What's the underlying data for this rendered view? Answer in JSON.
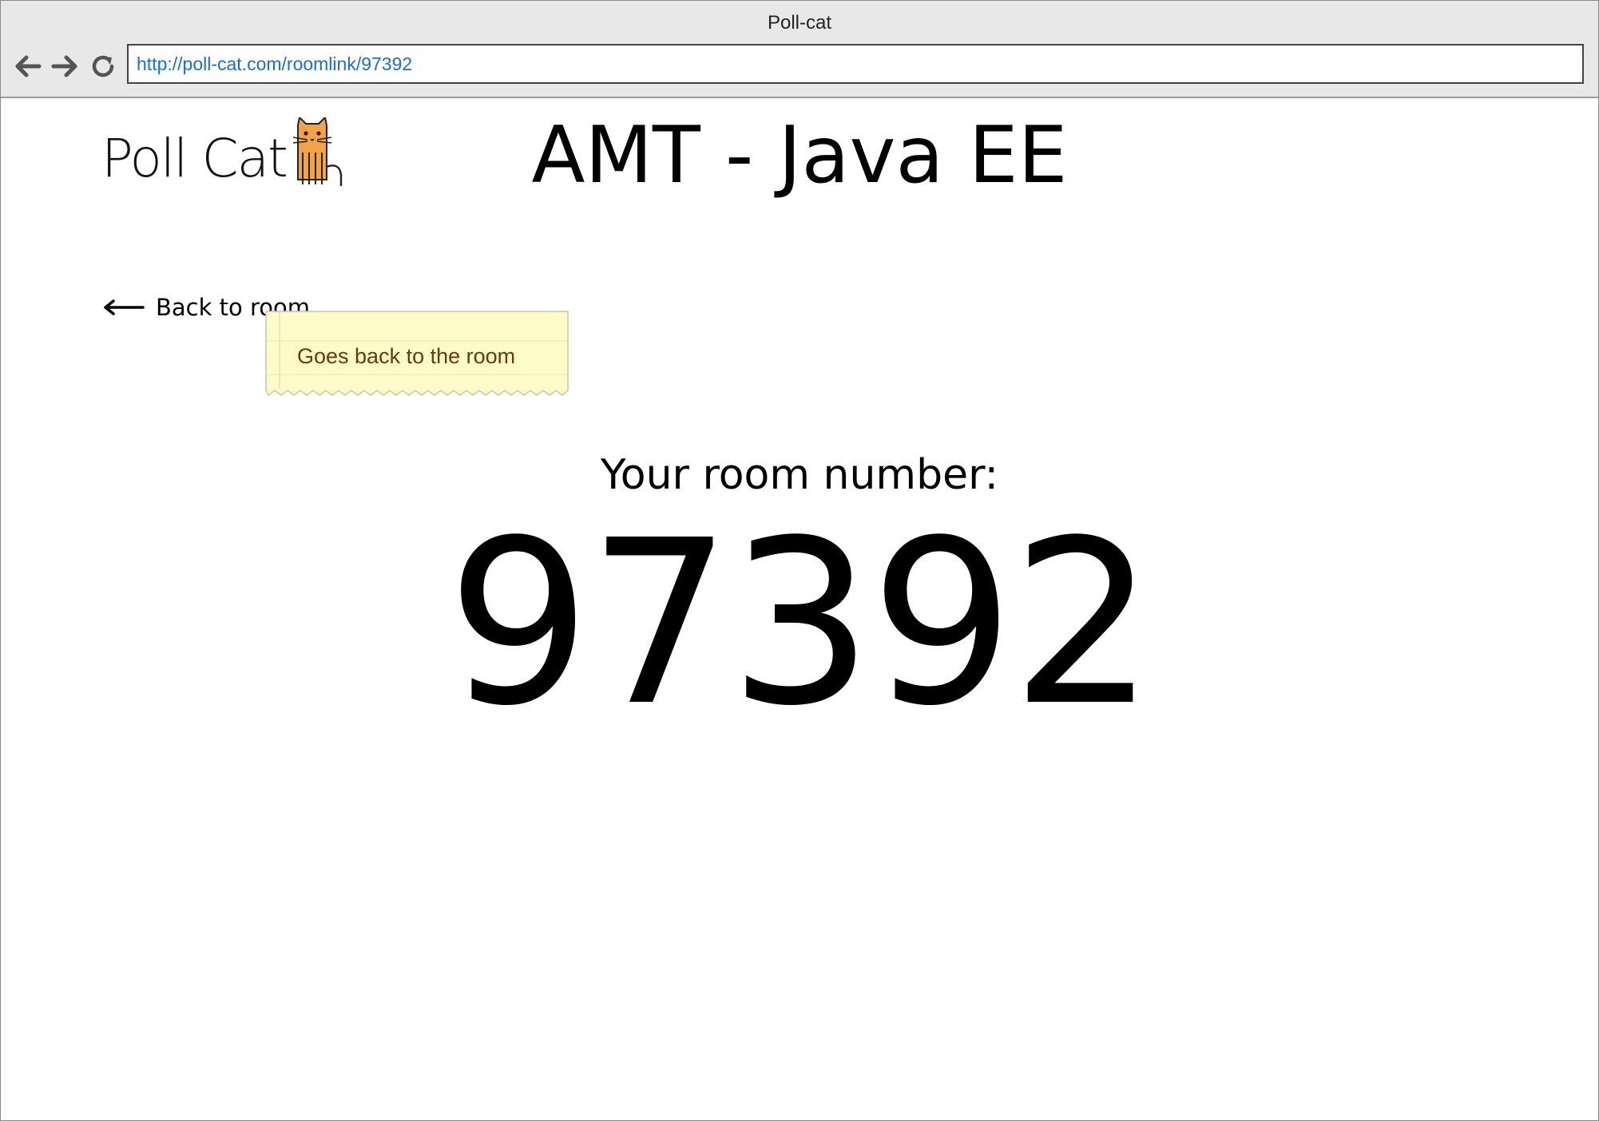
{
  "window": {
    "title": "Poll-cat"
  },
  "address_bar": {
    "url": "http://poll-cat.com/roomlink/97392"
  },
  "nav": {
    "back_icon": "arrow-left-icon",
    "forward_icon": "arrow-right-icon",
    "reload_icon": "reload-icon"
  },
  "logo": {
    "text": "Poll Cat",
    "icon": "cat-icon",
    "cat_color": "#f2a444"
  },
  "page": {
    "title": "AMT - Java EE"
  },
  "back_link": {
    "label": "Back to room",
    "icon": "long-arrow-left-icon"
  },
  "tooltip": {
    "text": "Goes back to the room",
    "background": "#fdfbc8",
    "text_color": "#6a3a0c"
  },
  "room": {
    "label": "Your room number:",
    "number": "97392"
  }
}
